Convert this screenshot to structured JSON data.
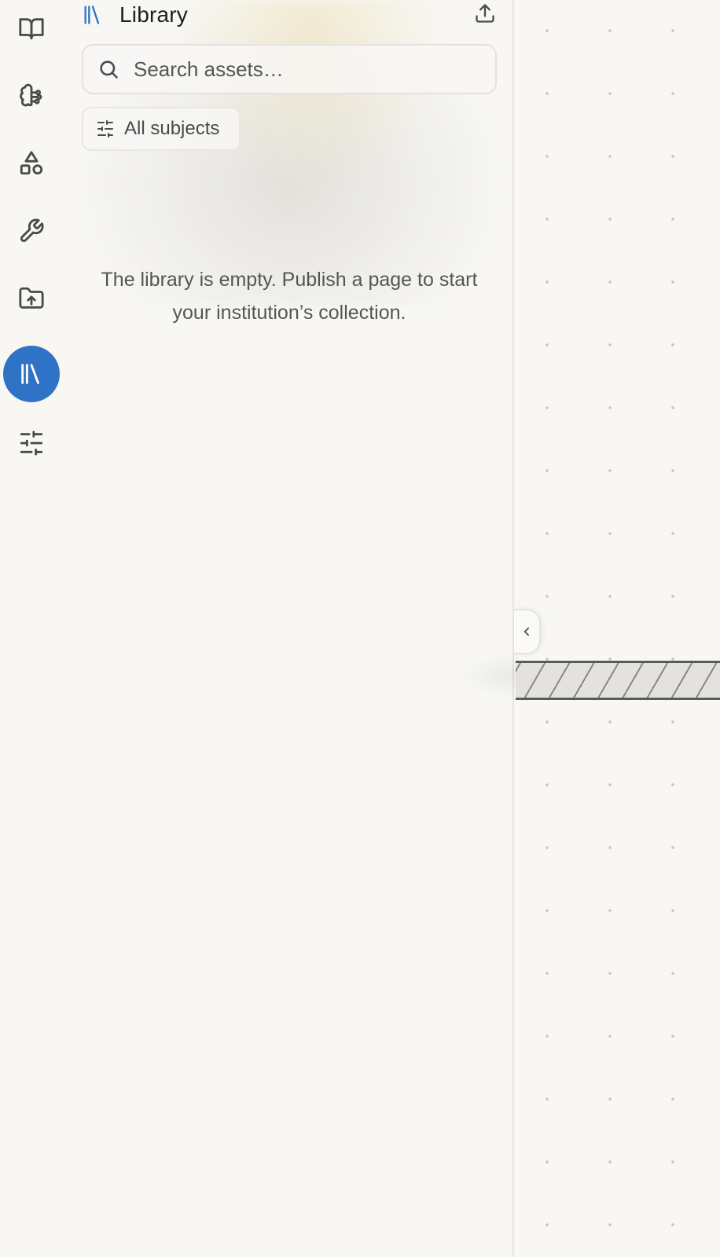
{
  "library": {
    "title": "Library",
    "search_placeholder": "Search assets…",
    "filter_label": "All subjects",
    "empty_message": "The library is empty. Publish a page to start your institution’s collection."
  },
  "rail": {
    "items": [
      {
        "icon": "book-open-icon",
        "active": false
      },
      {
        "icon": "brain-icon",
        "active": false
      },
      {
        "icon": "shapes-icon",
        "active": false
      },
      {
        "icon": "wrench-icon",
        "active": false
      },
      {
        "icon": "folder-upload-icon",
        "active": false
      },
      {
        "icon": "library-icon",
        "active": true
      },
      {
        "icon": "sliders-icon",
        "active": false
      }
    ]
  },
  "colors": {
    "accent": "#2f73c6",
    "background": "#f8f7f4",
    "text": "#3b3b3b"
  }
}
